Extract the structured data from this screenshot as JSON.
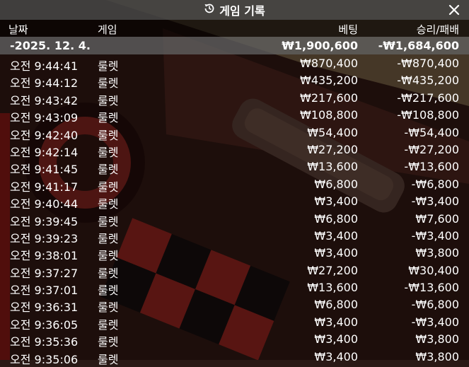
{
  "header": {
    "title": "게임 기록",
    "history_icon": "history-icon",
    "close_icon": "close-icon"
  },
  "columns": {
    "date": "날짜",
    "game": "게임",
    "bet": "베팅",
    "result": "승리/패배"
  },
  "summary": {
    "date": "-2025. 12. 4.",
    "bet": "₩1,900,600",
    "result": "-₩1,684,600"
  },
  "rows": [
    {
      "time": "오전 9:44:41",
      "game": "룰렛",
      "bet": "₩870,400",
      "result": "-₩870,400"
    },
    {
      "time": "오전 9:44:12",
      "game": "룰렛",
      "bet": "₩435,200",
      "result": "-₩435,200"
    },
    {
      "time": "오전 9:43:42",
      "game": "룰렛",
      "bet": "₩217,600",
      "result": "-₩217,600"
    },
    {
      "time": "오전 9:43:09",
      "game": "룰렛",
      "bet": "₩108,800",
      "result": "-₩108,800"
    },
    {
      "time": "오전 9:42:40",
      "game": "룰렛",
      "bet": "₩54,400",
      "result": "-₩54,400"
    },
    {
      "time": "오전 9:42:14",
      "game": "룰렛",
      "bet": "₩27,200",
      "result": "-₩27,200"
    },
    {
      "time": "오전 9:41:45",
      "game": "룰렛",
      "bet": "₩13,600",
      "result": "-₩13,600"
    },
    {
      "time": "오전 9:41:17",
      "game": "룰렛",
      "bet": "₩6,800",
      "result": "-₩6,800"
    },
    {
      "time": "오전 9:40:44",
      "game": "룰렛",
      "bet": "₩3,400",
      "result": "-₩3,400"
    },
    {
      "time": "오전 9:39:45",
      "game": "룰렛",
      "bet": "₩6,800",
      "result": "₩7,600"
    },
    {
      "time": "오전 9:39:23",
      "game": "룰렛",
      "bet": "₩3,400",
      "result": "-₩3,400"
    },
    {
      "time": "오전 9:38:01",
      "game": "룰렛",
      "bet": "₩3,400",
      "result": "₩3,800"
    },
    {
      "time": "오전 9:37:27",
      "game": "룰렛",
      "bet": "₩27,200",
      "result": "₩30,400"
    },
    {
      "time": "오전 9:37:01",
      "game": "룰렛",
      "bet": "₩13,600",
      "result": "-₩13,600"
    },
    {
      "time": "오전 9:36:31",
      "game": "룰렛",
      "bet": "₩6,800",
      "result": "-₩6,800"
    },
    {
      "time": "오전 9:36:05",
      "game": "룰렛",
      "bet": "₩3,400",
      "result": "-₩3,400"
    },
    {
      "time": "오전 9:35:36",
      "game": "룰렛",
      "bet": "₩3,400",
      "result": "₩3,800"
    },
    {
      "time": "오전 9:35:06",
      "game": "룰렛",
      "bet": "₩3,400",
      "result": "₩3,800"
    }
  ]
}
